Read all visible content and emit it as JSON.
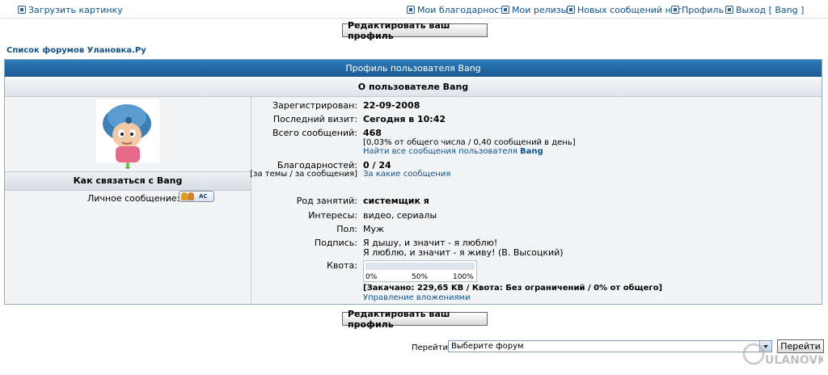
{
  "topnav": {
    "upload": "Загрузить картинку",
    "thanks": "Мои благодарности",
    "releases": "Мои релизы",
    "new_msgs": "Новых сообщений нет",
    "profile": "Профиль",
    "logout": "Выход [ Bang ]"
  },
  "edit_profile_label": "Редактировать ваш профиль",
  "forum_list_link": "Список форумов Улановка.Ру",
  "panel": {
    "title": "Профиль пользователя Bang",
    "about": "О пользователе Bang"
  },
  "contact": {
    "title": "Как связаться с Bang",
    "pm_label": "Личное сообщение:",
    "pm_button": "AC"
  },
  "profile": {
    "registered_label": "Зарегистрирован:",
    "registered_value": "22-09-2008",
    "last_visit_label": "Последний визит:",
    "last_visit_value": "Сегодня в 10:42",
    "posts_label": "Всего сообщений:",
    "posts_value": "468",
    "posts_stats": "[0,03% от общего числа / 0,40 сообщений в день]",
    "posts_find": "Найти все сообщения пользователя",
    "posts_find_user": "Bang",
    "thanks_label": "Благодарностей:",
    "thanks_sublabel": "[за темы / за сообщения]",
    "thanks_value": "0 / 24",
    "thanks_link": "За какие сообщения",
    "occupation_label": "Род занятий:",
    "occupation_value": "системщик я",
    "interests_label": "Интересы:",
    "interests_value": "видео, сериалы",
    "gender_label": "Пол:",
    "gender_value": "Муж",
    "signature_label": "Подпись:",
    "signature_line1": "Я дышу, и значит - я люблю!",
    "signature_line2": "Я люблю, и значит - я живу! (В. Высоцкий)",
    "quota_label": "Квота:",
    "quota_fraction": 0.0,
    "quota_ticks": [
      "0%",
      "50%",
      "100%"
    ],
    "quota_info": "[Закачано: 229,65 KB / Квота: Без ограничений / 0% от общего]",
    "attachments_link": "Управление вложениями"
  },
  "jump": {
    "label": "Перейти:",
    "selected": "Выберите форум",
    "go_button": "Перейти"
  },
  "watermark": "ULANOVKA"
}
